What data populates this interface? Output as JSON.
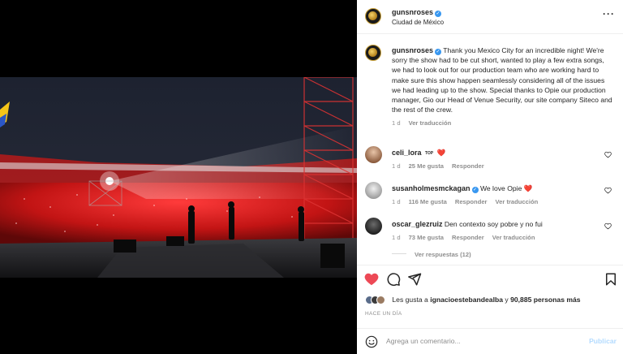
{
  "post": {
    "username": "gunsnroses",
    "location": "Ciudad de México",
    "verified_mark": "✓",
    "more_icon": "more-options-icon",
    "caption": "Thank you Mexico City for an incredible night! We're sorry the show had to be cut short, wanted to play a few extra songs, we had to look out for our production team who are working hard to make sure this show happen seamlessly considering all of the issues we had leading up to the show. Special thanks to Opie our production manager, Gio our Head of Venue Security, our site company Siteco and the rest of the crew.",
    "caption_time": "1 d",
    "see_translation": "Ver traducción"
  },
  "comments": [
    {
      "username": "celi_lora",
      "text": "❤️",
      "extra_badge": "TOP",
      "time": "1 d",
      "likes": "25 Me gusta",
      "reply": "Responder",
      "translate": ""
    },
    {
      "username": "susanholmesmckagan",
      "verified": true,
      "text": "We love Opie ❤️",
      "time": "1 d",
      "likes": "116 Me gusta",
      "reply": "Responder",
      "translate": "Ver traducción"
    },
    {
      "username": "oscar_glezruiz",
      "text": "Den contexto soy pobre y no fui",
      "time": "1 d",
      "likes": "73 Me gusta",
      "reply": "Responder",
      "translate": "Ver traducción"
    }
  ],
  "view_replies": "Ver respuestas (12)",
  "actions": {
    "like_icon": "heart-filled-icon",
    "comment_icon": "comment-icon",
    "share_icon": "share-icon",
    "save_icon": "bookmark-icon",
    "like_color": "#ed4956"
  },
  "likes_summary": {
    "prefix": "Les gusta a ",
    "user": "ignacioestebandealba",
    "middle": " y ",
    "count": "90,885 personas más"
  },
  "timestamp": "HACE UN DÍA",
  "add_comment": {
    "placeholder": "Agrega un comentario...",
    "publish_label": "Publicar",
    "emoji_icon": "emoji-icon"
  }
}
